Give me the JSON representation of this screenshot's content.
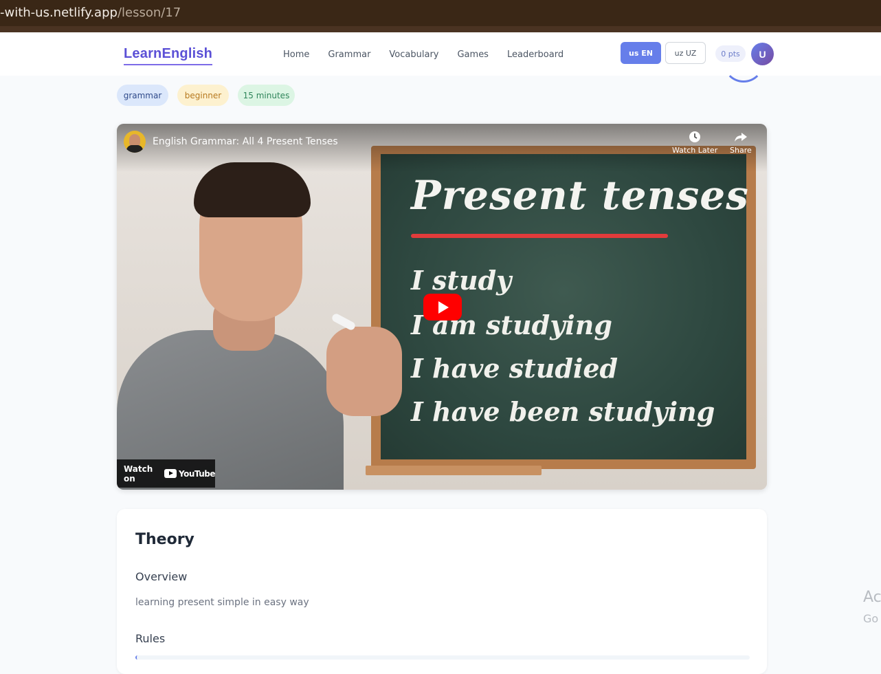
{
  "browser": {
    "url_host": "-with-us.netlify.app",
    "url_path": "/lesson/17"
  },
  "header": {
    "logo": "LearnEnglish",
    "nav": [
      "Home",
      "Grammar",
      "Vocabulary",
      "Games",
      "Leaderboard"
    ],
    "lang_en": "us EN",
    "lang_uz": "uz UZ",
    "points": "0 pts",
    "avatar_letter": "U"
  },
  "tags": {
    "category": "grammar",
    "level": "beginner",
    "duration": "15 minutes"
  },
  "video": {
    "title": "English Grammar: All 4 Present Tenses",
    "watch_later": "Watch Later",
    "share": "Share",
    "watch_on": "Watch on",
    "youtube": "YouTube",
    "board_title": "Present tenses",
    "board_lines": [
      "I study",
      "I am studying",
      "I have studied",
      "I have been studying"
    ]
  },
  "theory": {
    "heading": "Theory",
    "overview_heading": "Overview",
    "overview_text": "learning present simple in easy way",
    "rules_heading": "Rules"
  },
  "os_overlay": {
    "line1": "Ac",
    "line2": "Go"
  },
  "colors": {
    "accent": "#667eea",
    "brand": "#5b50d6",
    "youtube_red": "#ff0000"
  }
}
